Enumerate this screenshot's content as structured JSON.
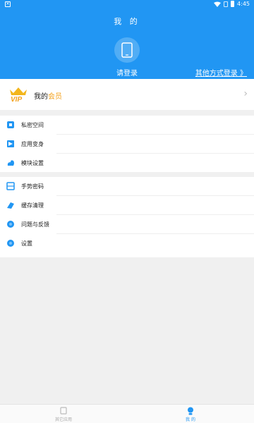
{
  "status_bar": {
    "time": "4:45",
    "icons": [
      "notification-icon",
      "wifi-icon",
      "sim-icon",
      "battery-icon"
    ]
  },
  "header": {
    "title": "我 的",
    "login_label": "请登录",
    "other_login_label": "其他方式登录 》"
  },
  "vip": {
    "badge": "VIP",
    "label_prefix": "我的",
    "label_highlight": "会员"
  },
  "menu_group_1": [
    {
      "label": "私密空间",
      "icon": "lock-shield-icon"
    },
    {
      "label": "应用变身",
      "icon": "app-disguise-icon"
    },
    {
      "label": "模块设置",
      "icon": "module-icon"
    }
  ],
  "menu_group_2": [
    {
      "label": "手势密码",
      "icon": "gesture-icon"
    },
    {
      "label": "缓存清理",
      "icon": "clean-icon"
    },
    {
      "label": "问题与反馈",
      "icon": "feedback-icon"
    },
    {
      "label": "设置",
      "icon": "settings-icon"
    }
  ],
  "bottom_nav": {
    "home_label": "其它应用",
    "me_label": "我 的"
  },
  "colors": {
    "primary": "#2196f3",
    "vip_gold": "#f3a11c",
    "background": "#f0f0f0"
  }
}
